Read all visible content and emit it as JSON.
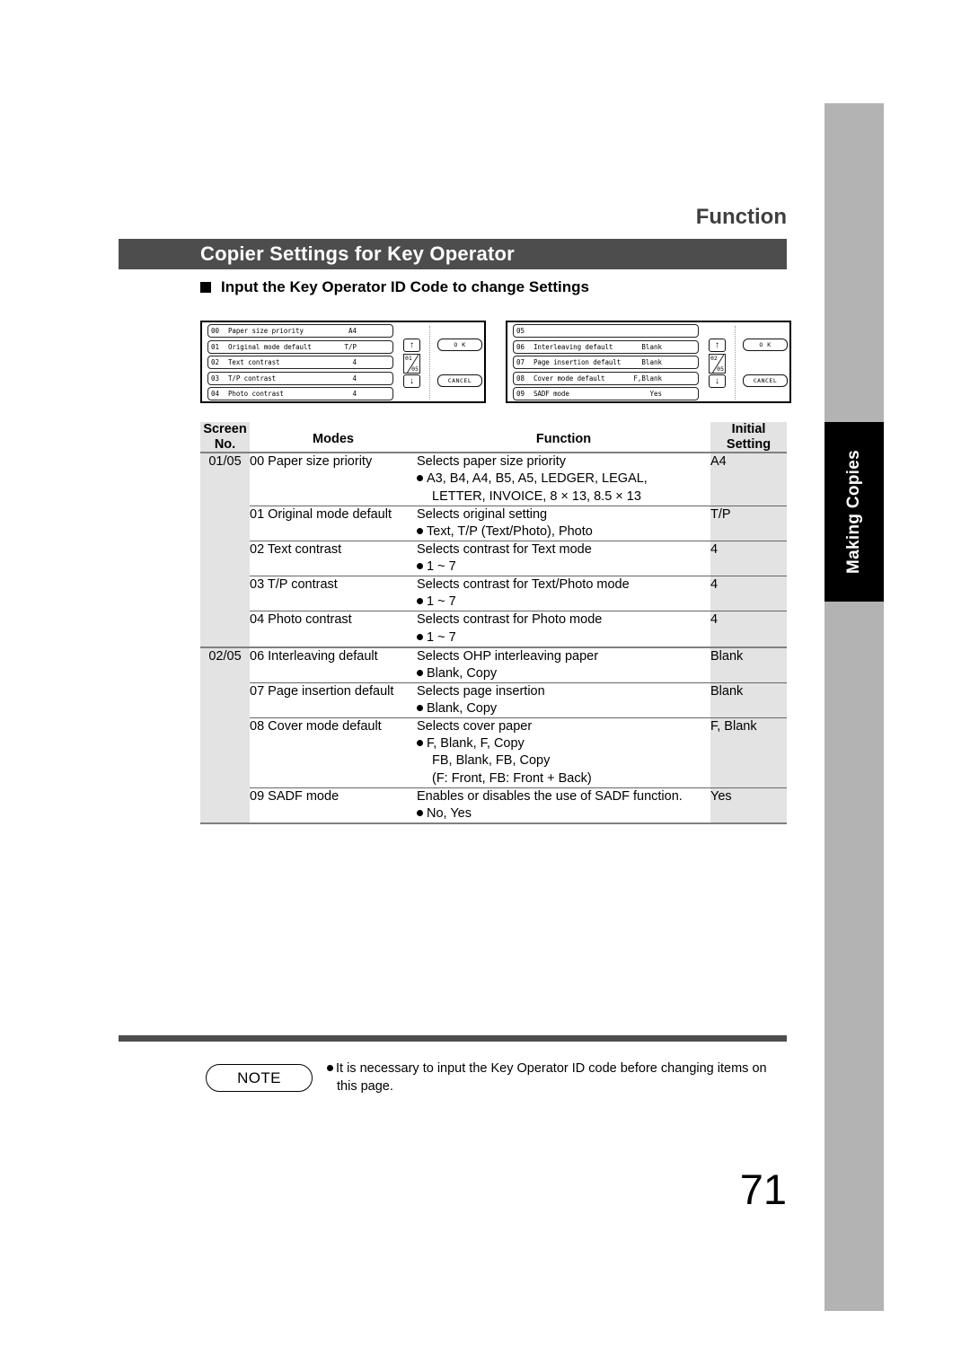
{
  "header": {
    "kicker": "Function",
    "title": "Copier Settings for Key Operator",
    "section_heading": "Input the Key Operator ID Code to change Settings"
  },
  "side_tab": {
    "label": "Making Copies",
    "bar_color": "#b3b3b3",
    "active_color": "#000000"
  },
  "lcd_panels": [
    {
      "page_top": "01",
      "page_bottom": "05",
      "ok_label": "O K",
      "cancel_label": "CANCEL",
      "up_arrow": "↑",
      "down_arrow": "↓",
      "rows": [
        {
          "no": "00",
          "name": "Paper size priority",
          "value": "A4"
        },
        {
          "no": "01",
          "name": "Original mode default",
          "value": "T/P"
        },
        {
          "no": "02",
          "name": "Text contrast",
          "value": "4"
        },
        {
          "no": "03",
          "name": "T/P contrast",
          "value": "4"
        },
        {
          "no": "04",
          "name": "Photo contrast",
          "value": "4"
        }
      ]
    },
    {
      "page_top": "02",
      "page_bottom": "05",
      "ok_label": "O K",
      "cancel_label": "CANCEL",
      "up_arrow": "↑",
      "down_arrow": "↓",
      "rows": [
        {
          "no": "05",
          "name": "",
          "value": ""
        },
        {
          "no": "06",
          "name": "Interleaving default",
          "value": "Blank"
        },
        {
          "no": "07",
          "name": "Page insertion default",
          "value": "Blank"
        },
        {
          "no": "08",
          "name": "Cover mode default",
          "value": "F,Blank"
        },
        {
          "no": "09",
          "name": "SADF mode",
          "value": "Yes"
        }
      ]
    }
  ],
  "table": {
    "headers": {
      "screen_no_l1": "Screen",
      "screen_no_l2": "No.",
      "modes": "Modes",
      "function": "Function",
      "initial_l1": "Initial",
      "initial_l2": "Setting"
    },
    "groups": [
      {
        "screen_no": "01/05",
        "rows": [
          {
            "mode": "00 Paper size priority",
            "function": "Selects paper size priority",
            "bullet": "A3, B4, A4, B5, A5, LEDGER, LEGAL,",
            "extra": "LETTER, INVOICE, 8 × 13, 8.5 × 13",
            "initial": "A4"
          },
          {
            "mode": "01 Original mode default",
            "function": "Selects original setting",
            "bullet": "Text, T/P (Text/Photo), Photo",
            "extra": "",
            "initial": "T/P"
          },
          {
            "mode": "02 Text contrast",
            "function": "Selects contrast for Text mode",
            "bullet": "1 ~ 7",
            "extra": "",
            "initial": "4"
          },
          {
            "mode": "03 T/P contrast",
            "function": "Selects contrast for Text/Photo mode",
            "bullet": "1 ~ 7",
            "extra": "",
            "initial": "4"
          },
          {
            "mode": "04 Photo contrast",
            "function": "Selects contrast for Photo mode",
            "bullet": "1 ~ 7",
            "extra": "",
            "initial": "4"
          }
        ]
      },
      {
        "screen_no": "02/05",
        "rows": [
          {
            "mode": "06 Interleaving default",
            "function": "Selects OHP interleaving paper",
            "bullet": "Blank, Copy",
            "extra": "",
            "initial": "Blank"
          },
          {
            "mode": "07 Page insertion default",
            "function": "Selects page insertion",
            "bullet": "Blank, Copy",
            "extra": "",
            "initial": "Blank"
          },
          {
            "mode": "08 Cover mode default",
            "function": "Selects cover paper",
            "bullet": "F, Blank, F, Copy",
            "extra": "FB, Blank, FB, Copy",
            "extra2": "(F: Front, FB: Front + Back)",
            "initial": "F, Blank"
          },
          {
            "mode": "09 SADF mode",
            "function": "Enables or disables the use of SADF function.",
            "bullet": "No, Yes",
            "extra": "",
            "initial": "Yes"
          }
        ]
      }
    ]
  },
  "note": {
    "badge": "NOTE",
    "line1": "It is necessary to input the Key Operator ID code before changing items on",
    "line2": "this page."
  },
  "page_number": "71"
}
